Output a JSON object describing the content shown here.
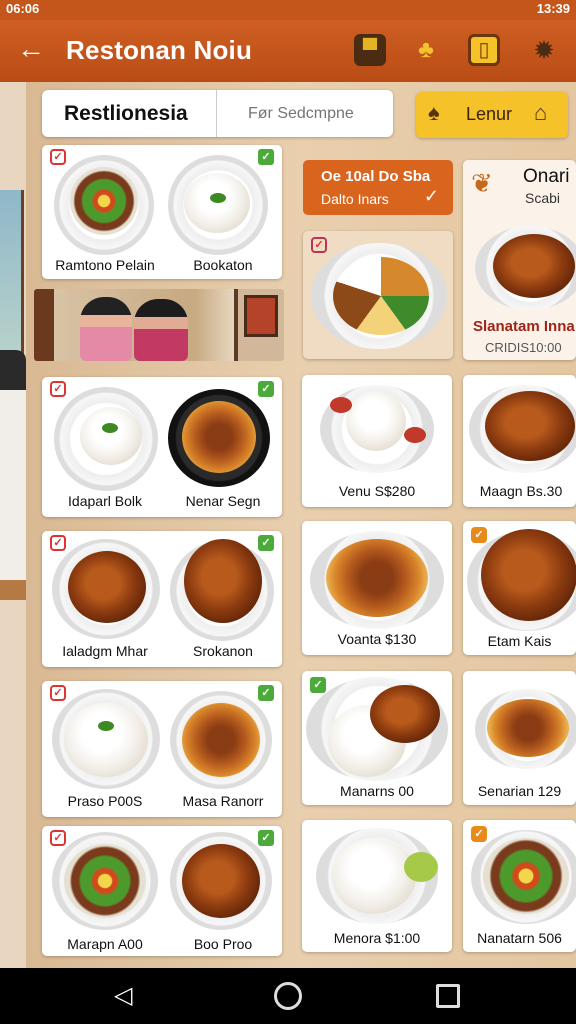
{
  "status_bar": {
    "left_text": "06:06",
    "right_text": "13:39"
  },
  "app_bar": {
    "title": "Restonan Noiu"
  },
  "search": {
    "left_label": "Restlionesia",
    "placeholder": "Før Sedcmpne"
  },
  "filter_button": {
    "label": "Lenur"
  },
  "promo": {
    "line1": "Oe 10al Do Sba",
    "line2": "Dalto Inars"
  },
  "featured": {
    "title": "Onari",
    "subtitle": "Scabi",
    "name": "Slanatam Inna",
    "price": "CRIDIS10:00"
  },
  "left_cards": [
    {
      "left_caption": "Ramtono Pelain",
      "right_caption": "Bookaton",
      "left_food": "salad",
      "right_food": "rice"
    },
    {
      "left_caption": "Idaparl Bolk",
      "right_caption": "Nenar Segn",
      "left_food": "rice",
      "right_food": "curry"
    },
    {
      "left_caption": "Ialadgm Mhar",
      "right_caption": "Srokanon",
      "left_food": "chicken",
      "right_food": "chicken"
    },
    {
      "left_caption": "Praso P00S",
      "right_caption": "Masa Ranorr",
      "left_food": "rice",
      "right_food": "curry"
    },
    {
      "left_caption": "Marapn A00",
      "right_caption": "Boo Proo",
      "left_food": "salad",
      "right_food": "chicken"
    }
  ],
  "center_cards": [
    {
      "caption": "Venu S$280",
      "food": "rice"
    },
    {
      "caption": "Voanta $130",
      "food": "curry"
    },
    {
      "caption": "Manarns 00",
      "food": "mix"
    },
    {
      "caption": "Menora $1:00",
      "food": "rice"
    }
  ],
  "right_cards": [
    {
      "caption": "Maagn Bs.30",
      "food": "chicken"
    },
    {
      "caption": "Etam Kais",
      "food": "chicken"
    },
    {
      "caption": "Senarian 129",
      "food": "curry"
    },
    {
      "caption": "Nanatarn 506",
      "food": "salad"
    }
  ],
  "icons": {
    "back": "arrow-left-icon",
    "actions": [
      "basket-icon",
      "ginger-icon",
      "calendar-icon",
      "gear-icon"
    ],
    "nav": [
      "back-triangle-icon",
      "home-circle-icon",
      "recents-square-icon"
    ]
  },
  "colors": {
    "app_bar": "#c4561c",
    "accent_yellow": "#f5c22a",
    "promo_orange": "#d9641e"
  }
}
